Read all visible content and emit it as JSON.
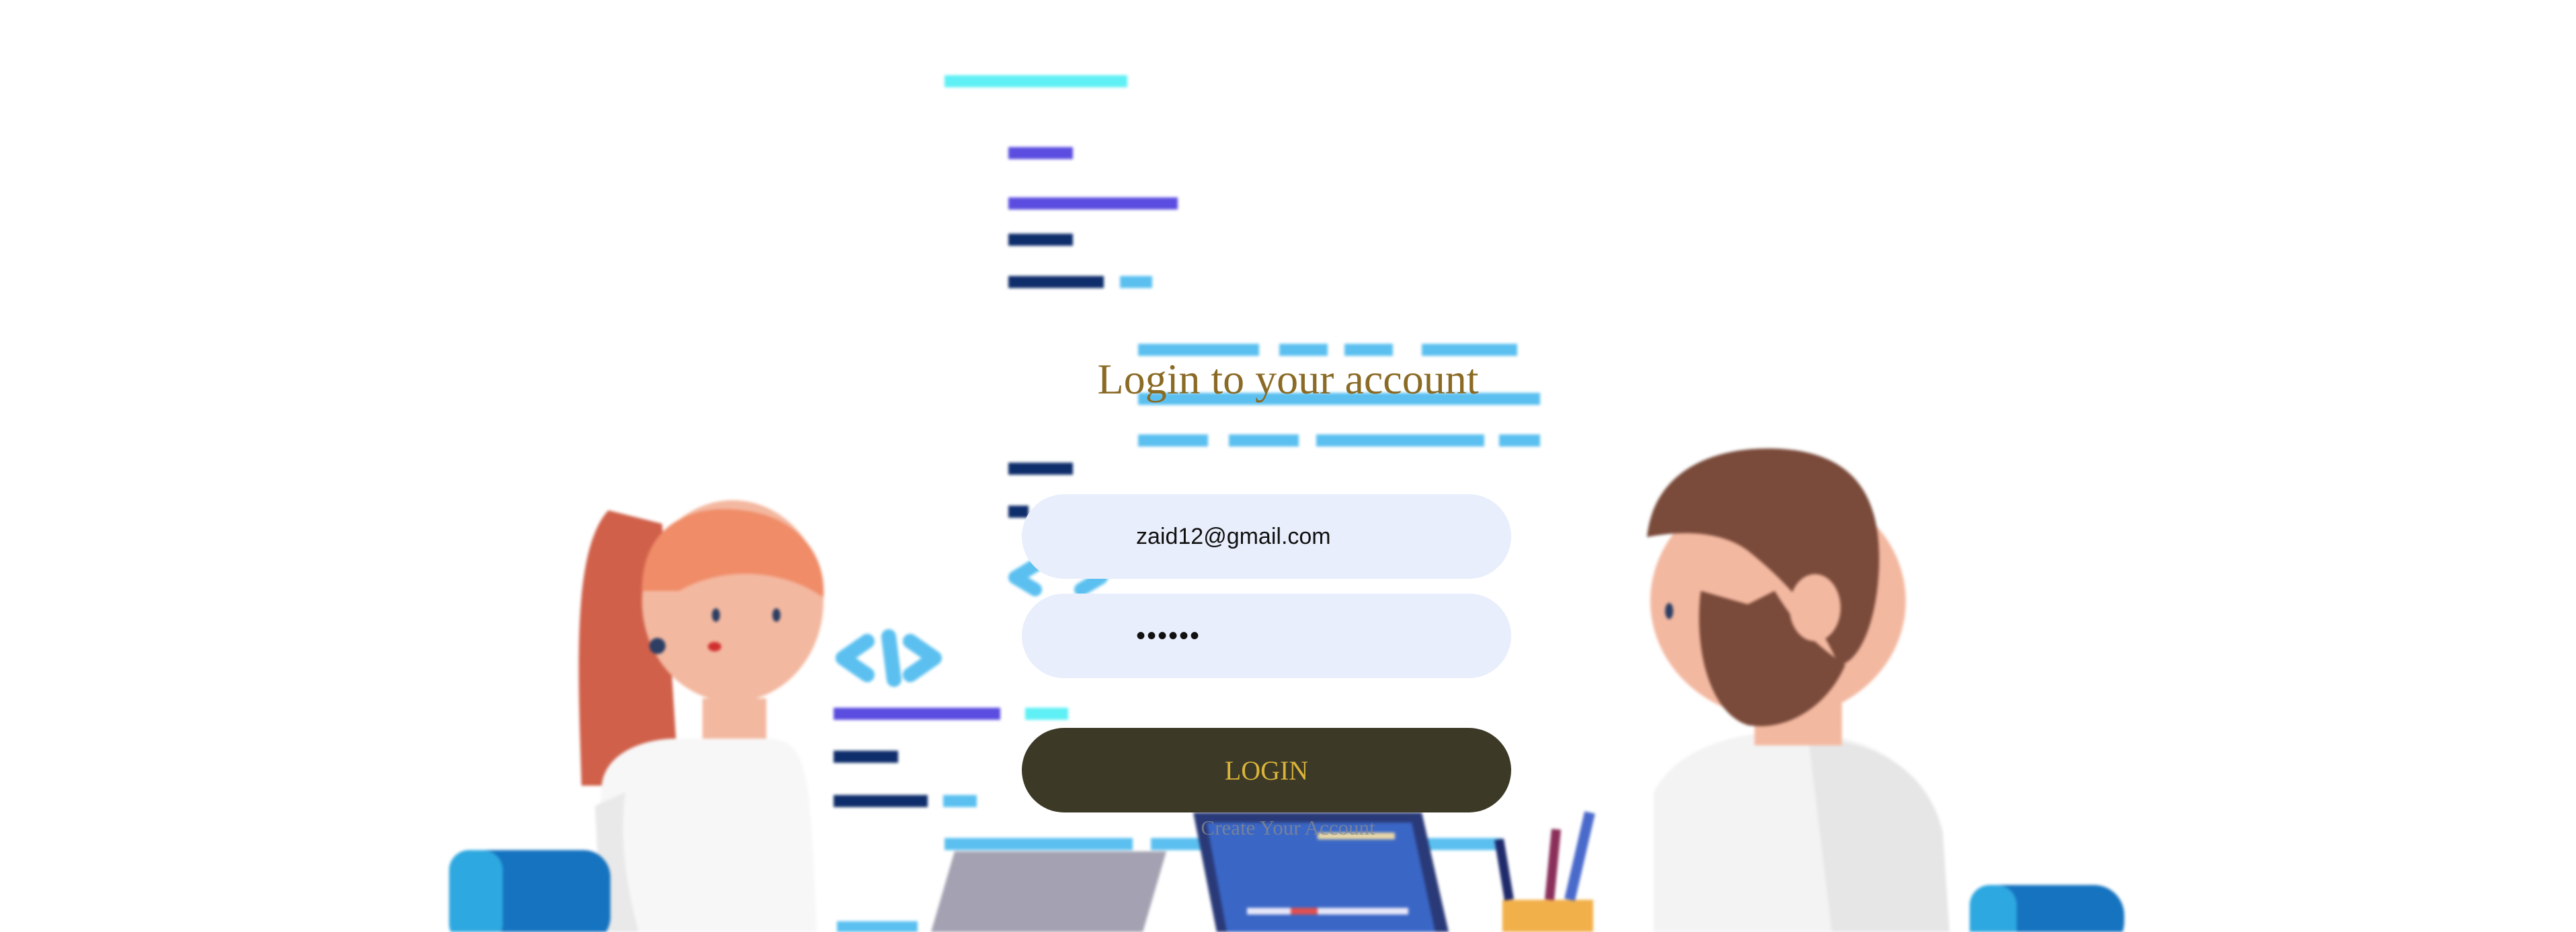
{
  "login": {
    "title": "Login to your account",
    "email_value": "zaid12@gmail.com",
    "password_value": "zaid12",
    "login_label": "LOGIN",
    "create_account_label": "Create Your Account"
  },
  "theme": {
    "title_color": "#8a6a24",
    "field_bg": "#e8eefb",
    "button_bg": "#3d3927",
    "button_text": "#d9b43a",
    "code_line_light": "#5bc0f0",
    "code_line_indigo": "#5b4de0",
    "code_line_navy": "#0e2d6b",
    "code_line_cyan": "#5ff0f5"
  },
  "background": {
    "illustration": "developers-coding-illustration",
    "icons": [
      "code-brackets-icon",
      "laptop-icon",
      "pen-cup-icon",
      "chair-icon"
    ]
  }
}
